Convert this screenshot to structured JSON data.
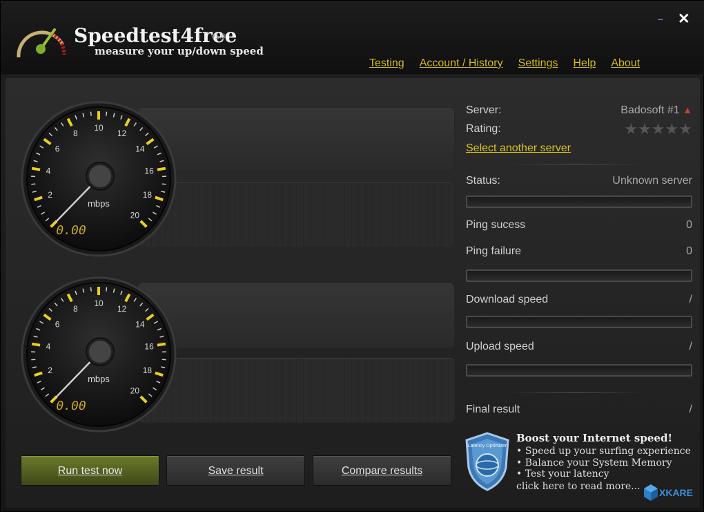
{
  "header": {
    "title": "Speedtest4free",
    "version": "v1.0",
    "tagline": "measure your up/down speed",
    "minimize": "–",
    "close": "✕",
    "nav": [
      "Testing",
      "Account / History",
      "Settings",
      "Help",
      "About"
    ]
  },
  "gauges": [
    {
      "unit": "mbps",
      "reading": "0.00",
      "ticks": [
        "2",
        "4",
        "6",
        "8",
        "10",
        "12",
        "14",
        "16",
        "18",
        "20"
      ],
      "needle_value": 0
    },
    {
      "unit": "mbps",
      "reading": "0.00",
      "ticks": [
        "2",
        "4",
        "6",
        "8",
        "10",
        "12",
        "14",
        "16",
        "18",
        "20"
      ],
      "needle_value": 0
    }
  ],
  "server_panel": {
    "server_label": "Server:",
    "server_value": "Badosoft #1",
    "rating_label": "Rating:",
    "rating_stars": 5,
    "rating_filled": 0,
    "select_server": "Select another server",
    "status_label": "Status:",
    "status_value": "Unknown server",
    "ping_success_label": "Ping sucess",
    "ping_success_value": "0",
    "ping_failure_label": "Ping failure",
    "ping_failure_value": "0",
    "download_label": "Download speed",
    "download_value": "/",
    "upload_label": "Upload speed",
    "upload_value": "/",
    "final_label": "Final result",
    "final_value": "/"
  },
  "buttons": {
    "run": "Run test now",
    "save": "Save result",
    "compare": "Compare results"
  },
  "promo": {
    "badge": "Latency Optimizer",
    "title": "Boost your Internet speed!",
    "items": [
      "Speed up your surfing experience",
      "Balance your System Memory",
      "Test your latency"
    ],
    "more": "click here to read more..."
  },
  "watermark": "XKARE",
  "colors": {
    "accent_yellow": "#d9c21c",
    "run_button": "#5a6a24",
    "gauge_tick": "#e8d020"
  }
}
